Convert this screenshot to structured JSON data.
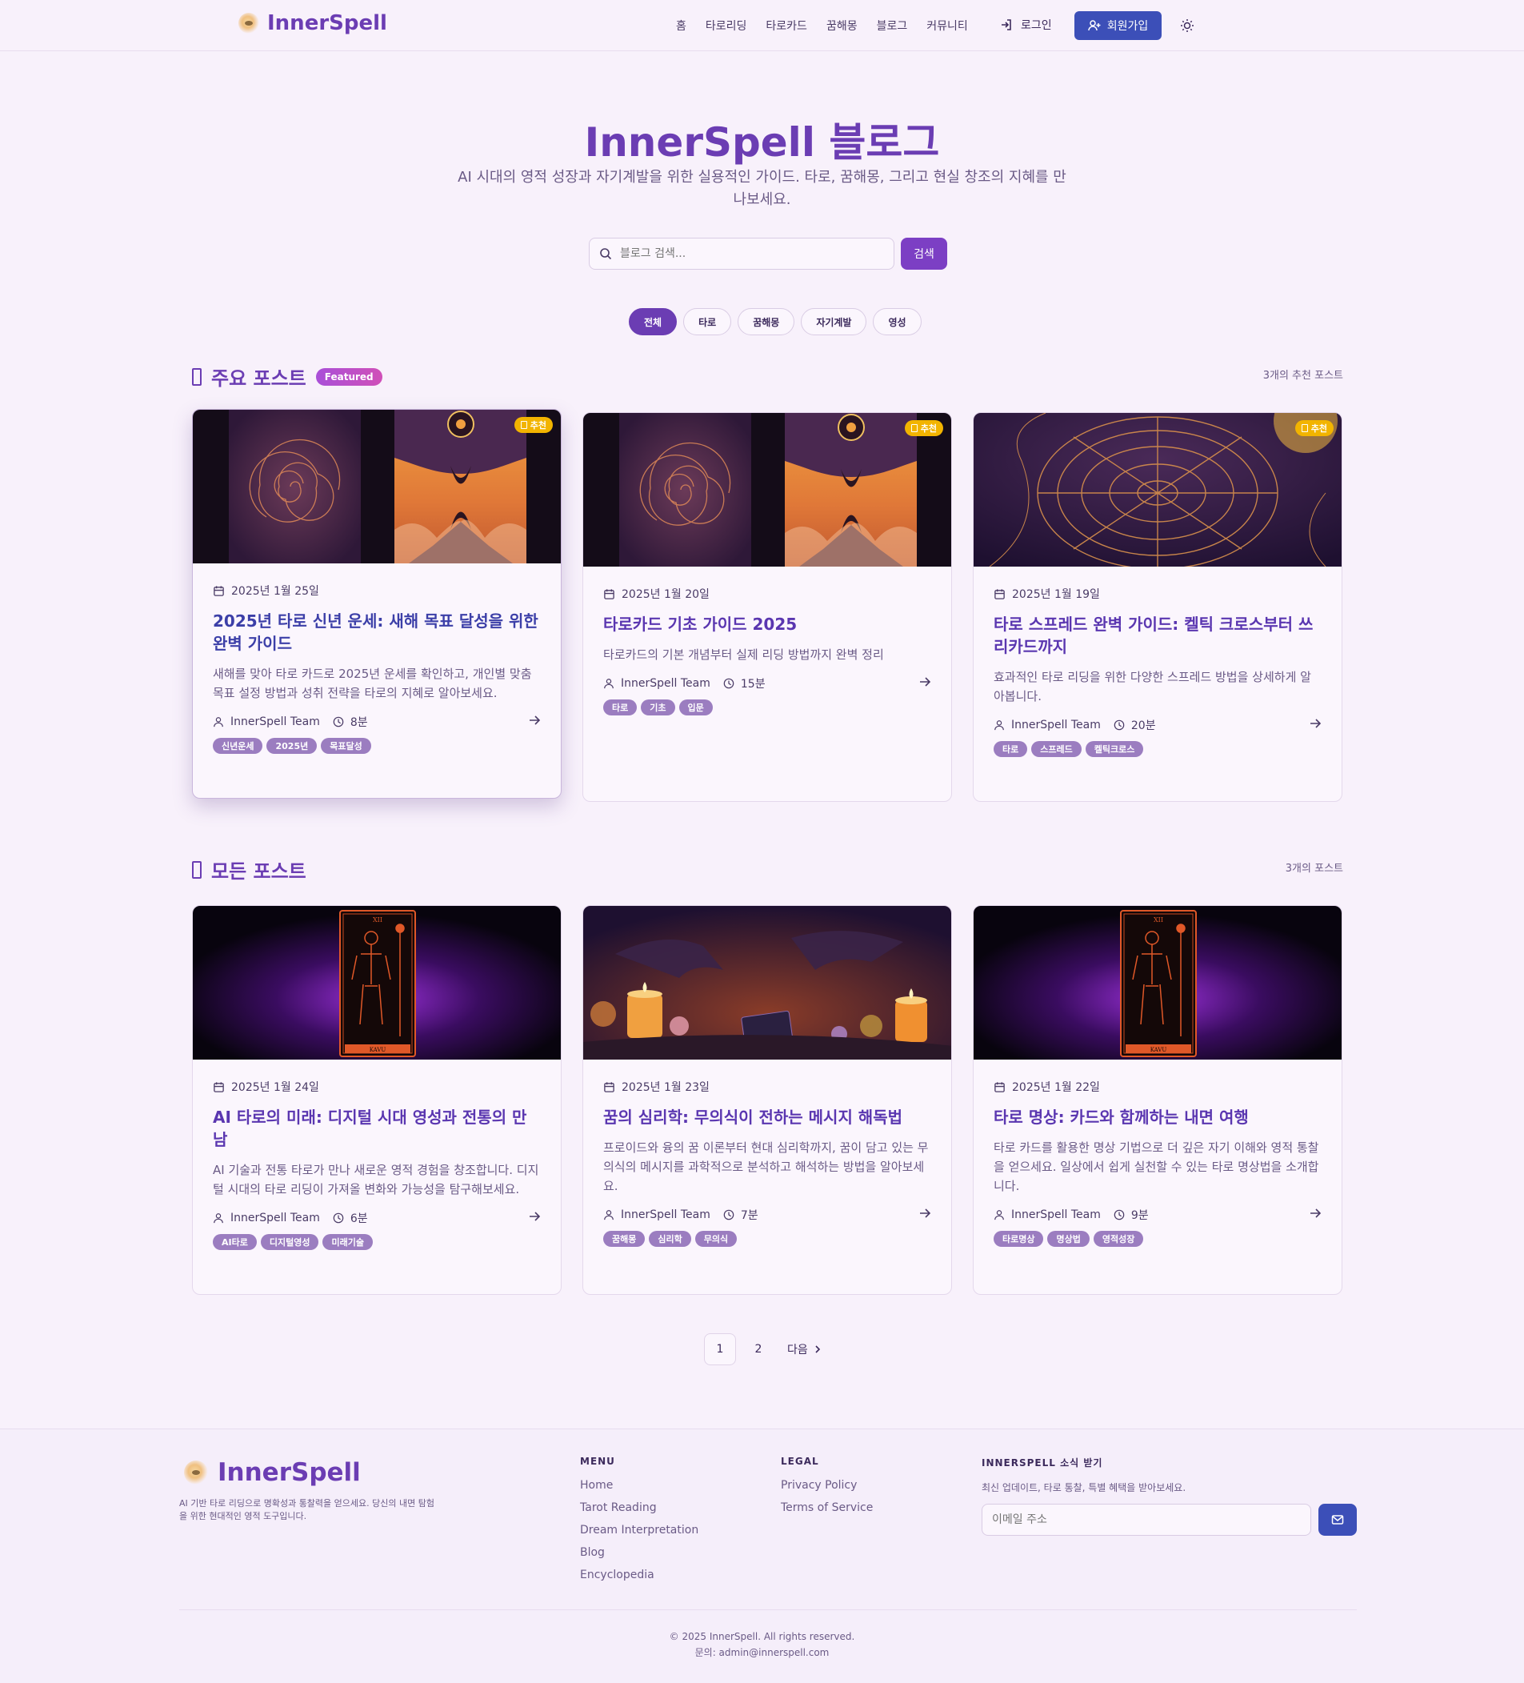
{
  "header": {
    "brand": "InnerSpell",
    "nav": [
      "홈",
      "타로리딩",
      "타로카드",
      "꿈해몽",
      "블로그",
      "커뮤니티"
    ],
    "login": "로그인",
    "signup": "회원가입"
  },
  "hero": {
    "title": "InnerSpell 블로그",
    "subtitle": "AI 시대의 영적 성장과 자기계발을 위한 실용적인 가이드. 타로, 꿈해몽, 그리고 현실 창조의 지혜를 만나보세요.",
    "search_placeholder": "블로그 검색...",
    "search_button": "검색"
  },
  "filters": [
    "전체",
    "타로",
    "꿈해몽",
    "자기계발",
    "영성"
  ],
  "featured": {
    "title": "주요 포스트",
    "badge": "Featured",
    "count": "3개의 추천 포스트",
    "rec_label": "추천",
    "posts": [
      {
        "date": "2025년 1월 25일",
        "title": "2025년 타로 신년 운세: 새해 목표 달성을 위한 완벽 가이드",
        "desc": "새해를 맞아 타로 카드로 2025년 운세를 확인하고, 개인별 맞춤 목표 설정 방법과 성취 전략을 타로의 지혜로 알아보세요.",
        "author": "InnerSpell Team",
        "read": "8분",
        "tags": [
          "신년운세",
          "2025년",
          "목표달성"
        ]
      },
      {
        "date": "2025년 1월 20일",
        "title": "타로카드 기초 가이드 2025",
        "desc": "타로카드의 기본 개념부터 실제 리딩 방법까지 완벽 정리",
        "author": "InnerSpell Team",
        "read": "15분",
        "tags": [
          "타로",
          "기초",
          "입문"
        ]
      },
      {
        "date": "2025년 1월 19일",
        "title": "타로 스프레드 완벽 가이드: 켈틱 크로스부터 쓰리카드까지",
        "desc": "효과적인 타로 리딩을 위한 다양한 스프레드 방법을 상세하게 알아봅니다.",
        "author": "InnerSpell Team",
        "read": "20분",
        "tags": [
          "타로",
          "스프레드",
          "켈틱크로스"
        ]
      }
    ]
  },
  "all": {
    "title": "모든 포스트",
    "count": "3개의 포스트",
    "posts": [
      {
        "date": "2025년 1월 24일",
        "title": "AI 타로의 미래: 디지털 시대 영성과 전통의 만남",
        "desc": "AI 기술과 전통 타로가 만나 새로운 영적 경험을 창조합니다. 디지털 시대의 타로 리딩이 가져올 변화와 가능성을 탐구해보세요.",
        "author": "InnerSpell Team",
        "read": "6분",
        "tags": [
          "AI타로",
          "디지털영성",
          "미래기술"
        ]
      },
      {
        "date": "2025년 1월 23일",
        "title": "꿈의 심리학: 무의식이 전하는 메시지 해독법",
        "desc": "프로이드와 융의 꿈 이론부터 현대 심리학까지, 꿈이 담고 있는 무의식의 메시지를 과학적으로 분석하고 해석하는 방법을 알아보세요.",
        "author": "InnerSpell Team",
        "read": "7분",
        "tags": [
          "꿈해몽",
          "심리학",
          "무의식"
        ]
      },
      {
        "date": "2025년 1월 22일",
        "title": "타로 명상: 카드와 함께하는 내면 여행",
        "desc": "타로 카드를 활용한 명상 기법으로 더 깊은 자기 이해와 영적 통찰을 얻으세요. 일상에서 쉽게 실천할 수 있는 타로 명상법을 소개합니다.",
        "author": "InnerSpell Team",
        "read": "9분",
        "tags": [
          "타로명상",
          "명상법",
          "영적성장"
        ]
      }
    ]
  },
  "card_image_text": {
    "roman": "XII",
    "name": "KAVU"
  },
  "pagination": {
    "pages": [
      "1",
      "2"
    ],
    "next": "다음"
  },
  "footer": {
    "brand": "InnerSpell",
    "desc": "AI 기반 타로 리딩으로 명확성과 통찰력을 얻으세요. 당신의 내면 탐험을 위한 현대적인 영적 도구입니다.",
    "menu_title": "MENU",
    "menu": [
      "Home",
      "Tarot Reading",
      "Dream Interpretation",
      "Blog",
      "Encyclopedia"
    ],
    "legal_title": "LEGAL",
    "legal": [
      "Privacy Policy",
      "Terms of Service"
    ],
    "news_title": "INNERSPELL 소식 받기",
    "news_sub": "최신 업데이트, 타로 통찰, 특별 혜택을 받아보세요.",
    "email_placeholder": "이메일 주소",
    "copyright": "© 2025 InnerSpell. All rights reserved.",
    "contact": "문의: admin@innerspell.com"
  },
  "colors": {
    "brand": "#6b3db3",
    "primary_button": "#3c4fb8",
    "recommend_badge": "#f2b400",
    "tag": "#9b7dc0"
  }
}
